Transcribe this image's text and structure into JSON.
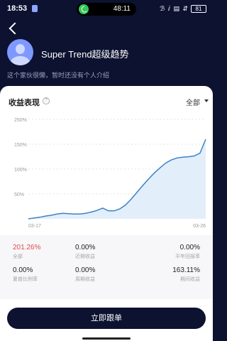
{
  "status_bar": {
    "time": "18:53",
    "call_time": "48:11",
    "icons": "ℬ ⅈ ▤ ⇵",
    "battery": "81"
  },
  "profile": {
    "name": "Super Trend超级趋势",
    "description": "这个家伙很懒，暂时还没有个人介绍"
  },
  "card": {
    "title": "收益表现",
    "help": "?",
    "range_label": "全部"
  },
  "chart_data": {
    "type": "area",
    "title": "",
    "xlabel": "",
    "ylabel": "",
    "ytick_labels": [
      "250%",
      "150%",
      "100%",
      "50%"
    ],
    "xtick_labels": [
      "03-17",
      "03-26"
    ],
    "ylim": [
      0,
      250
    ],
    "values": [
      0,
      2,
      4,
      7,
      9,
      12,
      14,
      13,
      12,
      12,
      14,
      17,
      21,
      27,
      20,
      20,
      25,
      35,
      50,
      67,
      84,
      100,
      115,
      128,
      140,
      148,
      153,
      155,
      156,
      158,
      165,
      200
    ],
    "colors": {
      "line": "#3b82c9",
      "fill": "#e3eefb",
      "grid": "#e6e6e6"
    }
  },
  "stats": [
    {
      "value": "201.26%",
      "label": "全部"
    },
    {
      "value": "0.00%",
      "label": "近期收益"
    },
    {
      "value": "0.00%",
      "label": "平年回报率"
    },
    {
      "value": "0.00%",
      "label": "夏普比例率"
    },
    {
      "value": "0.00%",
      "label": "周期收益"
    },
    {
      "value": "163.11%",
      "label": "期间收益"
    }
  ],
  "action": {
    "follow_label": "立即跟单"
  }
}
